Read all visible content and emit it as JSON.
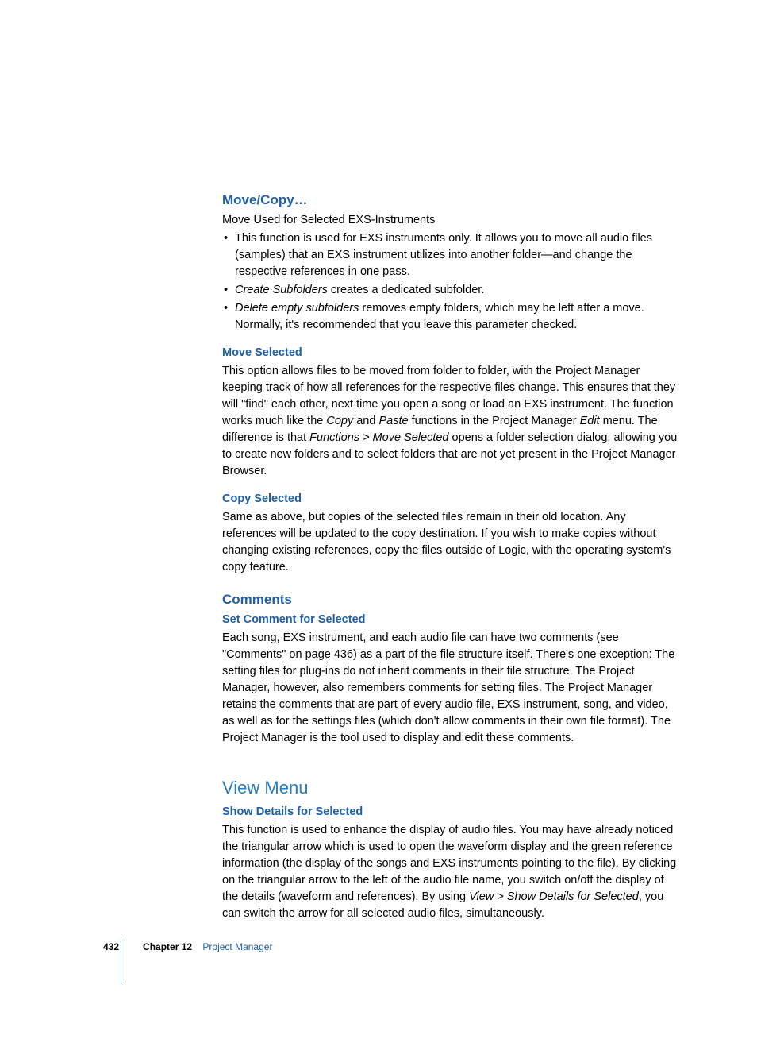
{
  "sections": {
    "moveCopy": {
      "heading": "Move/Copy…",
      "intro": "Move Used for Selected EXS-Instruments",
      "bullet1": "This function is used for EXS instruments only. It allows you to move all audio files (samples) that an EXS instrument utilizes into another folder—and change the respective references in one pass.",
      "bullet2_em": "Create Subfolders",
      "bullet2_rest": " creates a dedicated subfolder.",
      "bullet3_em": "Delete empty subfolders",
      "bullet3_rest": " removes empty folders, which may be left after a move. Normally, it's recommended that you leave this parameter checked."
    },
    "moveSelected": {
      "heading": "Move Selected",
      "p1a": "This option allows files to be moved from folder to folder, with the Project Manager keeping track of how all references for the respective files change. This ensures that they will \"find\" each other, next time you open a song or load an EXS instrument. The function works much like the ",
      "p1_em1": "Copy",
      "p1b": " and ",
      "p1_em2": "Paste",
      "p1c": " functions in the Project Manager ",
      "p1_em3": "Edit",
      "p1d": " menu. The difference is that ",
      "p1_em4": "Functions > Move Selected",
      "p1e": " opens a folder selection dialog, allowing you to create new folders and to select folders that are not yet present in the Project Manager Browser."
    },
    "copySelected": {
      "heading": "Copy Selected",
      "p1": "Same as above, but copies of the selected files remain in their old location. Any references will be updated to the copy destination. If you wish to make copies without changing existing references, copy the files outside of Logic, with the operating system's copy feature."
    },
    "comments": {
      "heading": "Comments",
      "sub": "Set Comment for Selected",
      "p1": "Each song, EXS instrument, and each audio file can have two comments (see \"Comments\" on page 436) as a part of the file structure itself. There's one exception:  The setting files for plug-ins do not inherit comments in their file structure. The Project Manager, however, also remembers comments for setting files. The Project Manager retains the comments that are part of every audio file, EXS instrument, song, and video, as well as for the settings files (which don't allow comments in their own file format). The Project Manager is the tool used to display and edit these comments."
    },
    "viewMenu": {
      "heading": "View Menu",
      "sub": "Show Details for Selected",
      "p1a": "This function is used to enhance the display of audio files. You may have already noticed the triangular arrow which is used to open the waveform display and the green reference information (the display of the songs and EXS instruments pointing to the file). By clicking on the triangular arrow to the left of the audio file name, you switch on/off the display of the details (waveform and references). By using ",
      "p1_em": "View > Show Details for Selected",
      "p1b": ", you can switch the arrow for all selected audio files, simultaneously."
    }
  },
  "footer": {
    "page": "432",
    "chapter": "Chapter 12",
    "title": "Project Manager"
  }
}
